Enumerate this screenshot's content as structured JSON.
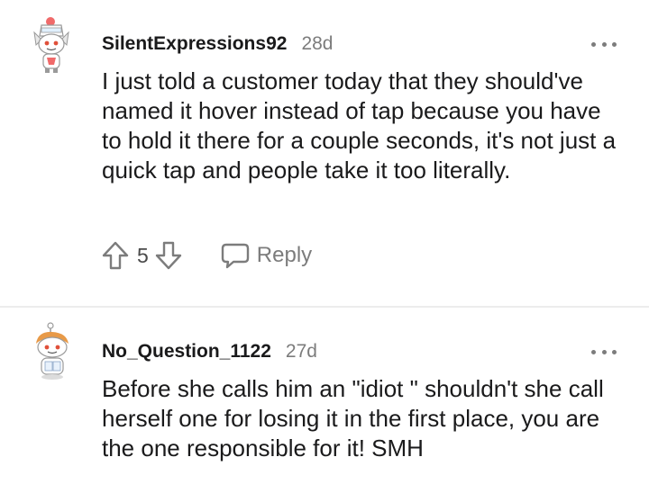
{
  "comments": [
    {
      "username": "SilentExpressions92",
      "age": "28d",
      "body": "I just told a customer today that they should've named it hover instead of tap because you have to hold it there for a couple seconds, it's not just a quick tap and people take it too literally.",
      "score": "5",
      "reply_label": "Reply",
      "avatar_icon": "snoo-avatar-icon"
    },
    {
      "username": "No_Question_1122",
      "age": "27d",
      "body": "Before she calls him an \"idiot \" shouldn't she call herself one for losing it in the first place, you are the one responsible for it! SMH",
      "avatar_icon": "snoo-avatar-icon"
    }
  ],
  "colors": {
    "text": "#1a1a1b",
    "meta": "#7c7c7c",
    "divider": "#ececec"
  }
}
